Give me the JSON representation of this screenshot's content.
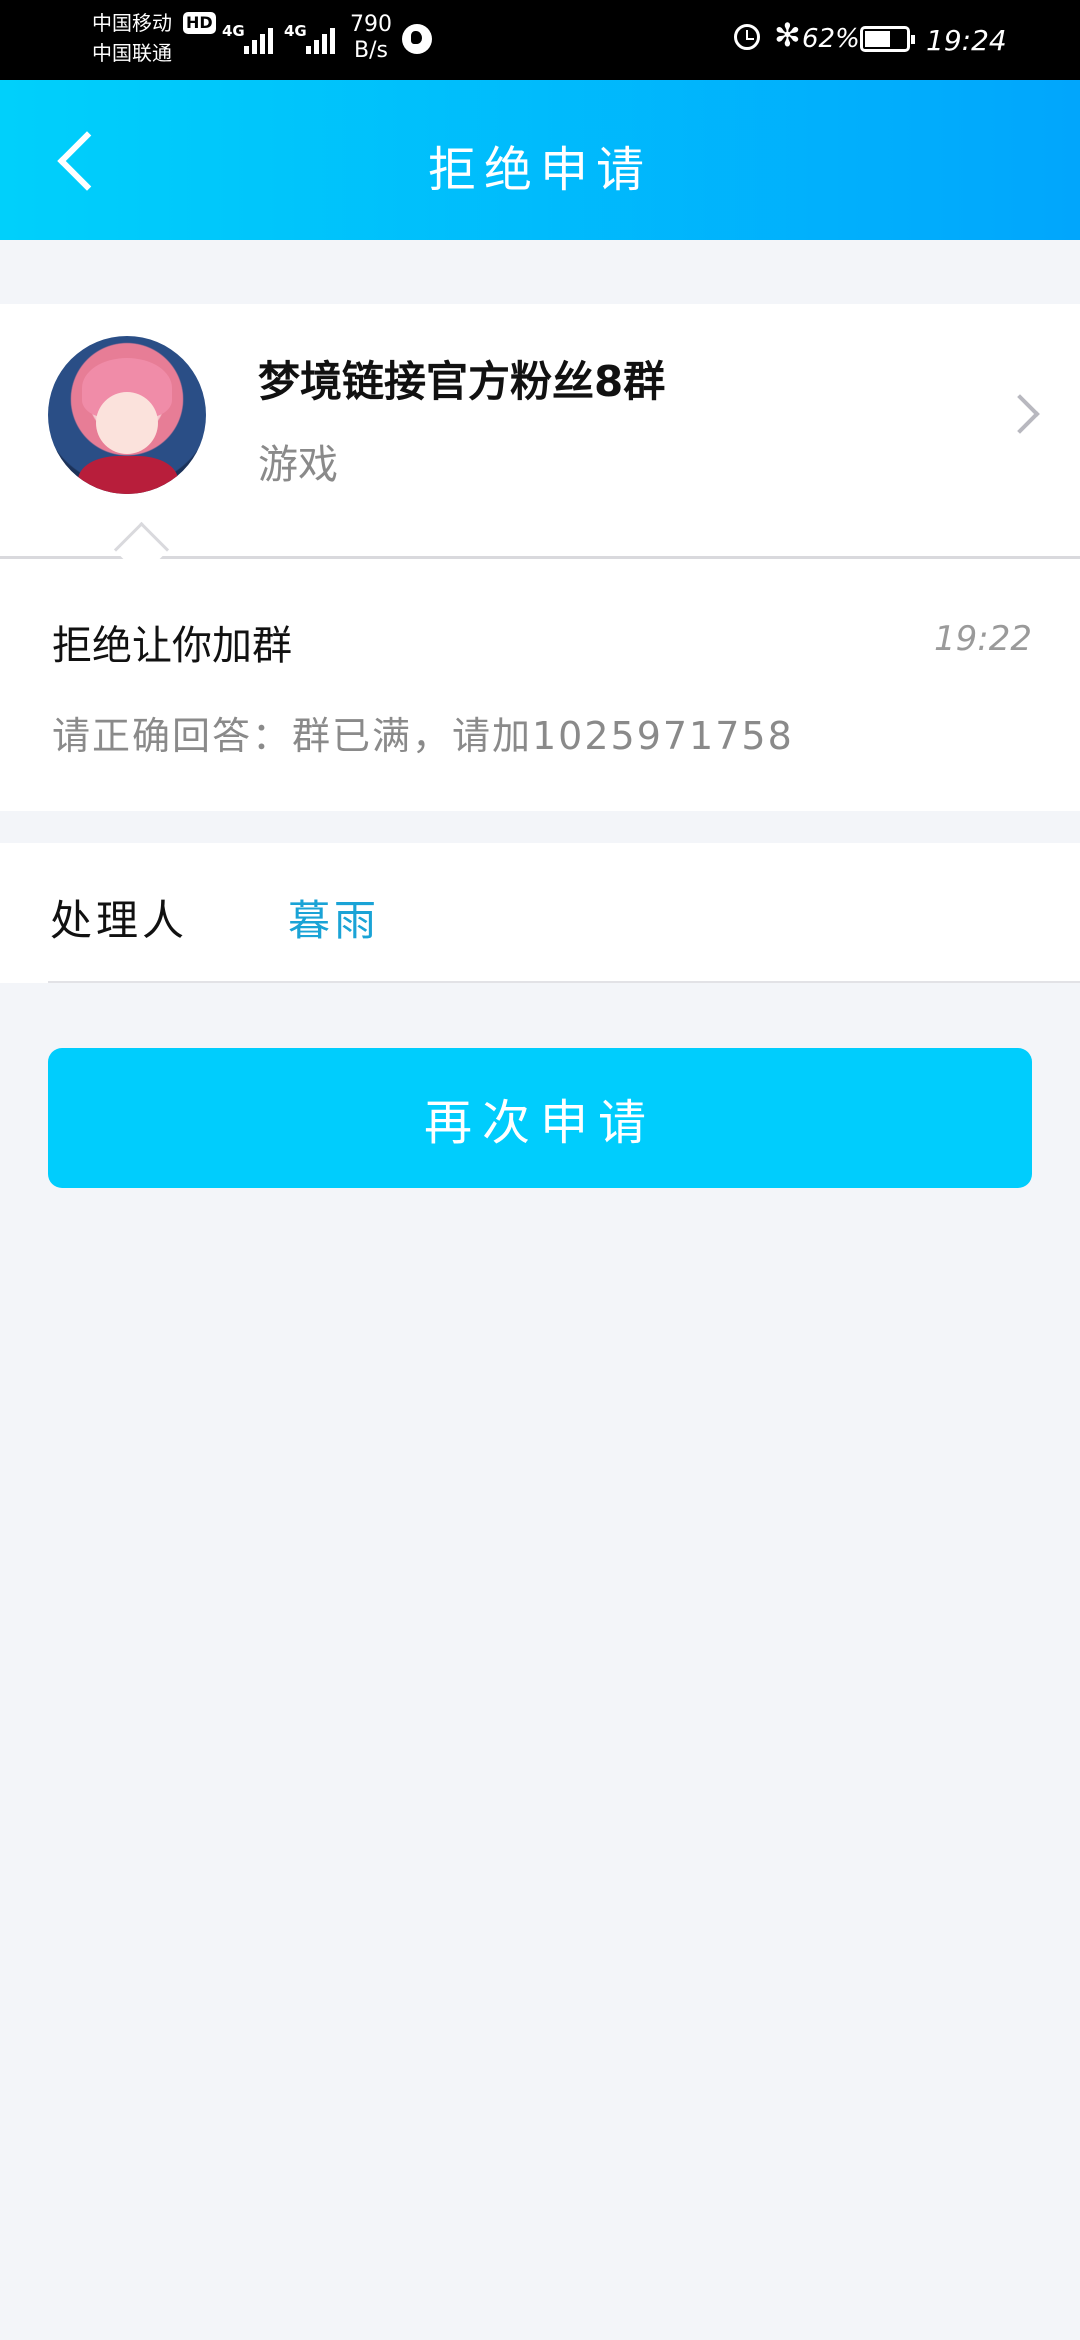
{
  "status_bar": {
    "carrier1": "中国移动",
    "carrier2": "中国联通",
    "hd": "HD",
    "net1": "4G",
    "net2": "4G",
    "speed_value": "790",
    "speed_unit": "B/s",
    "bluetooth": "✻",
    "battery_pct": "62%",
    "battery_level": 0.62,
    "time": "19:24"
  },
  "header": {
    "title": "拒绝申请"
  },
  "group": {
    "name": "梦境链接官方粉丝8群",
    "category": "游戏"
  },
  "message": {
    "title": "拒绝让你加群",
    "time": "19:22",
    "body": "请正确回答：群已满，请加1025971758"
  },
  "handler": {
    "label": "处理人",
    "name": "暮雨"
  },
  "actions": {
    "reapply_label": "再次申请"
  }
}
